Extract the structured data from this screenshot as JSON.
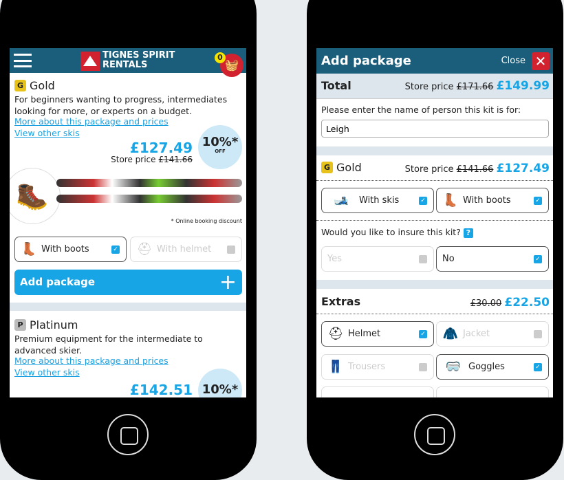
{
  "left": {
    "brand": {
      "line1": "TIGNES SPIRIT",
      "line2": "RENTALS"
    },
    "cart_count": "0",
    "gold": {
      "badge": "G",
      "title": "Gold",
      "description": "For beginners wanting to progress, intermediates looking for more, or experts on a budget.",
      "more_link": "More about this package and prices",
      "skis_link": "View other skis",
      "price": "£127.49",
      "store_label": "Store price",
      "store_price": "£141.66",
      "discount": "10%*",
      "discount_off": "OFF",
      "note": "* Online booking discount",
      "options": [
        {
          "label": "With boots",
          "checked": true
        },
        {
          "label": "With helmet",
          "checked": false
        }
      ],
      "add_label": "Add package"
    },
    "platinum": {
      "badge": "P",
      "title": "Platinum",
      "description": "Premium equipment for the intermediate to advanced skier.",
      "more_link": "More about this package and prices",
      "skis_link": "View other skis",
      "price": "£142.51",
      "discount": "10%*"
    }
  },
  "right": {
    "title": "Add package",
    "close": "Close",
    "total": {
      "label": "Total",
      "store_label": "Store price",
      "store_price": "£171.66",
      "price": "£149.99"
    },
    "name_prompt": "Please enter the name of person this kit is for:",
    "name_value": "Leigh",
    "gold": {
      "badge": "G",
      "title": "Gold",
      "store_label": "Store price",
      "store_price": "£141.66",
      "price": "£127.49",
      "options": [
        {
          "label": "With skis",
          "checked": true
        },
        {
          "label": "With boots",
          "checked": true
        }
      ]
    },
    "insure": {
      "question": "Would you like to insure this kit?",
      "help": "?",
      "yes": "Yes",
      "no": "No",
      "selected": "No"
    },
    "extras": {
      "label": "Extras",
      "old_price": "£30.00",
      "price": "£22.50",
      "items": [
        {
          "label": "Helmet",
          "checked": true
        },
        {
          "label": "Jacket",
          "checked": false
        },
        {
          "label": "Trousers",
          "checked": false
        },
        {
          "label": "Goggles",
          "checked": true
        }
      ]
    }
  },
  "colors": {
    "header": "#1b5e7b",
    "accent": "#18a5e6",
    "close": "#d3222f",
    "gold_badge": "#e6c21a"
  }
}
